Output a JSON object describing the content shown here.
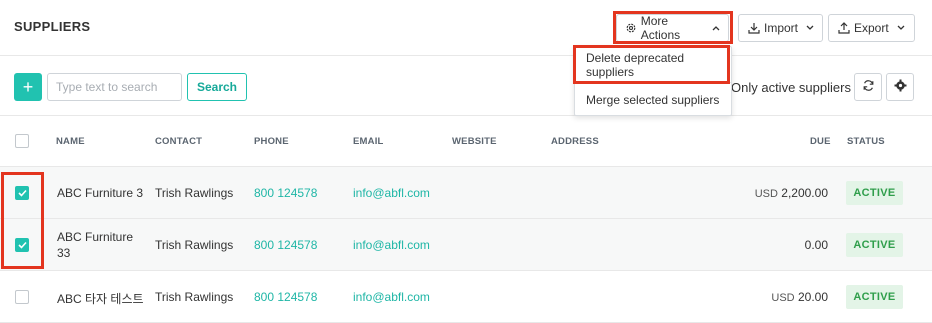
{
  "header": {
    "title": "SUPPLIERS",
    "more_actions_label": "More Actions",
    "import_label": "Import",
    "export_label": "Export"
  },
  "dropdown": {
    "items": [
      "Delete deprecated suppliers",
      "Merge selected suppliers"
    ]
  },
  "toolbar": {
    "add_label": "+",
    "search_placeholder": "Type text to search",
    "search_label": "Search",
    "active_filter_label": "Only active suppliers"
  },
  "table": {
    "columns": [
      "NAME",
      "CONTACT",
      "PHONE",
      "EMAIL",
      "WEBSITE",
      "ADDRESS",
      "DUE",
      "STATUS"
    ],
    "rows": [
      {
        "checked": true,
        "name": "ABC Furniture 3",
        "name_line2": "",
        "contact": "Trish Rawlings",
        "phone": "800 124578",
        "email": "info@abfl.com",
        "website": "",
        "address": "",
        "due_currency": "USD",
        "due_amount": "2,200.00",
        "status": "ACTIVE"
      },
      {
        "checked": true,
        "name": "ABC Furniture",
        "name_line2": "33",
        "contact": "Trish Rawlings",
        "phone": "800 124578",
        "email": "info@abfl.com",
        "website": "",
        "address": "",
        "due_currency": "",
        "due_amount": "0.00",
        "status": "ACTIVE"
      },
      {
        "checked": false,
        "name": "ABC 타자 테스트",
        "name_line2": "",
        "contact": "Trish Rawlings",
        "phone": "800 124578",
        "email": "info@abfl.com",
        "website": "",
        "address": "",
        "due_currency": "USD",
        "due_amount": "20.00",
        "status": "ACTIVE"
      }
    ]
  },
  "colors": {
    "accent": "#21c2b0",
    "annotation": "#e3351f",
    "status_bg": "#e3f4e7",
    "status_text": "#2f9e4b"
  }
}
